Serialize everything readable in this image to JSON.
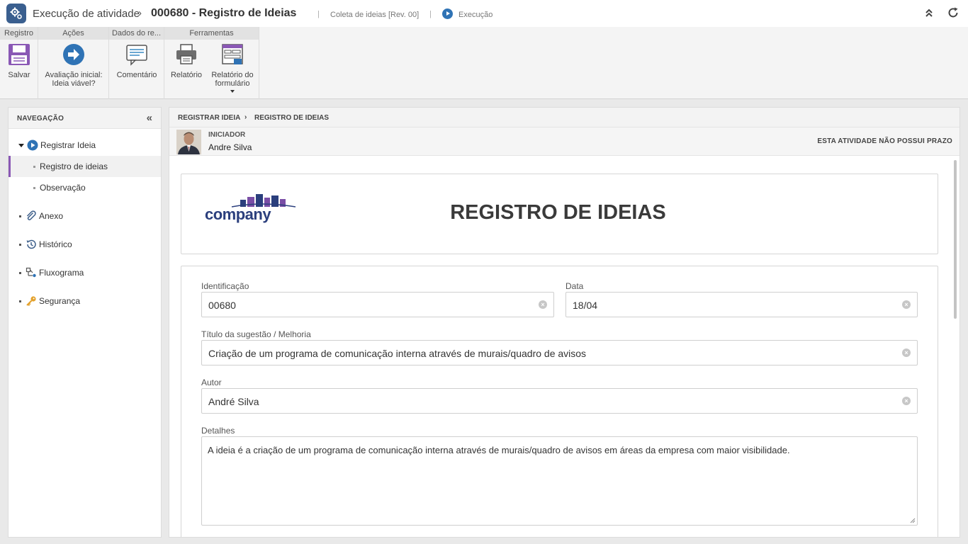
{
  "header": {
    "app_title": "Execução de atividade",
    "record_title": "000680 - Registro de Ideias",
    "process_name": "Coleta de ideias [Rev. 00]",
    "status": "Execução",
    "separator": "|"
  },
  "ribbon": {
    "groups": [
      {
        "label": "Registro"
      },
      {
        "label": "Ações"
      },
      {
        "label": "Dados do re..."
      },
      {
        "label": "Ferramentas"
      }
    ],
    "buttons": {
      "save": "Salvar",
      "evaluate_line1": "Avaliação inicial:",
      "evaluate_line2": "Ideia viável?",
      "comment": "Comentário",
      "report": "Relatório",
      "form_report_line1": "Relatório do",
      "form_report_line2": "formulário"
    }
  },
  "navigation": {
    "title": "NAVEGAÇÃO",
    "items": [
      {
        "label": "Registrar Ideia",
        "icon": "play-circle-icon"
      },
      {
        "label": "Registro de ideias",
        "selected": true
      },
      {
        "label": "Observação"
      },
      {
        "label": "Anexo",
        "icon": "paperclip-icon"
      },
      {
        "label": "Histórico",
        "icon": "history-icon"
      },
      {
        "label": "Fluxograma",
        "icon": "flowchart-icon"
      },
      {
        "label": "Segurança",
        "icon": "key-icon"
      }
    ]
  },
  "content": {
    "breadcrumb": [
      "REGISTRAR IDEIA",
      "REGISTRO DE IDEIAS"
    ],
    "initiator_label": "INICIADOR",
    "initiator_name": "Andre Silva",
    "deadline": "ESTA ATIVIDADE NÃO POSSUI PRAZO",
    "logo_text": "company",
    "form_title": "REGISTRO DE IDEIAS",
    "fields": {
      "identificacao": {
        "label": "Identificação",
        "value": "00680"
      },
      "data": {
        "label": "Data",
        "value": "18/04"
      },
      "titulo": {
        "label": "Título da sugestão / Melhoria",
        "value": "Criação de um programa de comunicação interna através de murais/quadro de avisos"
      },
      "autor": {
        "label": "Autor",
        "value": "André Silva"
      },
      "detalhes": {
        "label": "Detalhes",
        "value": "A  ideia é a criação de um programa de comunicação interna através de murais/quadro de avisos em áreas da empresa com maior visibilidade."
      }
    }
  },
  "colors": {
    "accent": "#8a58b5",
    "brand": "#3a5f8f",
    "status_blue": "#2f73b5",
    "logo_blue": "#2b3f7d"
  }
}
